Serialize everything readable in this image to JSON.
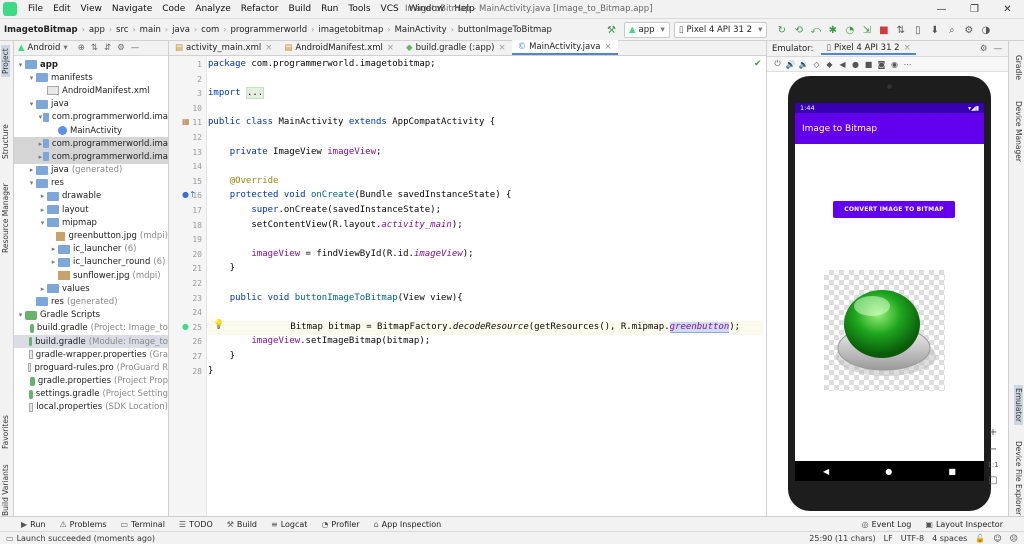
{
  "menu": {
    "items": [
      "File",
      "Edit",
      "View",
      "Navigate",
      "Code",
      "Analyze",
      "Refactor",
      "Build",
      "Run",
      "Tools",
      "VCS",
      "Window",
      "Help"
    ],
    "title": "ImagetoBitmap - MainActivity.java [Image_to_Bitmap.app]"
  },
  "navbar": {
    "crumbs": [
      "ImagetoBitmap",
      "app",
      "src",
      "main",
      "java",
      "com",
      "programmerworld",
      "imagetobitmap",
      "MainActivity",
      "buttonImageToBitmap"
    ],
    "run_config": "app",
    "device": "Pixel 4 API 31 2"
  },
  "leftstrip": {
    "project": "Project",
    "structure": "Structure",
    "resource_manager": "Resource Manager",
    "favorites": "Favorites",
    "build_variants": "Build Variants"
  },
  "rightstrip": {
    "gradle": "Gradle",
    "device_manager": "Device Manager",
    "emulator": "Emulator",
    "device_file_explorer": "Device File Explorer"
  },
  "project": {
    "view": "Android",
    "tree": [
      {
        "label": "app",
        "indent": 0,
        "icon": "fold",
        "arrow": "v",
        "bold": true
      },
      {
        "label": "manifests",
        "indent": 1,
        "icon": "fold",
        "arrow": "v"
      },
      {
        "label": "AndroidManifest.xml",
        "indent": 2,
        "icon": "fdoc",
        "arrow": ""
      },
      {
        "label": "java",
        "indent": 1,
        "icon": "fold",
        "arrow": "v"
      },
      {
        "label": "com.programmerworld.ima",
        "indent": 2,
        "icon": "fold",
        "arrow": "v"
      },
      {
        "label": "MainActivity",
        "indent": 3,
        "icon": "fcls",
        "arrow": ""
      },
      {
        "label": "com.programmerworld.ima",
        "indent": 2,
        "icon": "fold",
        "arrow": ">",
        "cls": "hl"
      },
      {
        "label": "com.programmerworld.ima",
        "indent": 2,
        "icon": "fold",
        "arrow": ">",
        "cls": "hl"
      },
      {
        "label": "java",
        "dim": "(generated)",
        "indent": 1,
        "icon": "fold",
        "arrow": ">"
      },
      {
        "label": "res",
        "indent": 1,
        "icon": "fold",
        "arrow": "v"
      },
      {
        "label": "drawable",
        "indent": 2,
        "icon": "fold",
        "arrow": ">"
      },
      {
        "label": "layout",
        "indent": 2,
        "icon": "fold",
        "arrow": ">"
      },
      {
        "label": "mipmap",
        "indent": 2,
        "icon": "fold",
        "arrow": "v"
      },
      {
        "label": "greenbutton.jpg",
        "dim": "(mdpi)",
        "indent": 3,
        "icon": "fimg",
        "arrow": ""
      },
      {
        "label": "ic_launcher",
        "dim": "(6)",
        "indent": 3,
        "icon": "fold",
        "arrow": ">"
      },
      {
        "label": "ic_launcher_round",
        "dim": "(6)",
        "indent": 3,
        "icon": "fold",
        "arrow": ">"
      },
      {
        "label": "sunflower.jpg",
        "dim": "(mdpi)",
        "indent": 3,
        "icon": "fimg",
        "arrow": ""
      },
      {
        "label": "values",
        "indent": 2,
        "icon": "fold",
        "arrow": ">"
      },
      {
        "label": "res",
        "dim": "(generated)",
        "indent": 1,
        "icon": "fold",
        "arrow": ""
      },
      {
        "label": "Gradle Scripts",
        "indent": 0,
        "icon": "fgr",
        "arrow": "v"
      },
      {
        "label": "build.gradle",
        "dim": "(Project: Image_to",
        "indent": 1,
        "icon": "fgr",
        "arrow": ""
      },
      {
        "label": "build.gradle",
        "dim": "(Module: Image_to",
        "indent": 1,
        "icon": "fgr",
        "arrow": "",
        "cls": "hlsel"
      },
      {
        "label": "gradle-wrapper.properties",
        "dim": "(Gra",
        "indent": 1,
        "icon": "fdoc",
        "arrow": ""
      },
      {
        "label": "proguard-rules.pro",
        "dim": "(ProGuard R",
        "indent": 1,
        "icon": "fdoc",
        "arrow": ""
      },
      {
        "label": "gradle.properties",
        "dim": "(Project Prop",
        "indent": 1,
        "icon": "fgr",
        "arrow": ""
      },
      {
        "label": "settings.gradle",
        "dim": "(Project Setting",
        "indent": 1,
        "icon": "fgr",
        "arrow": ""
      },
      {
        "label": "local.properties",
        "dim": "(SDK Location)",
        "indent": 1,
        "icon": "fdoc",
        "arrow": ""
      }
    ]
  },
  "tabs": [
    {
      "label": "activity_main.xml",
      "active": false
    },
    {
      "label": "AndroidManifest.xml",
      "active": false
    },
    {
      "label": "build.gradle (:app)",
      "active": false
    },
    {
      "label": "MainActivity.java",
      "active": true
    }
  ],
  "code": {
    "line_numbers": [
      "1",
      "2",
      "3",
      "10",
      "11",
      "12",
      "13",
      "14",
      "15",
      "16",
      "17",
      "18",
      "19",
      "20",
      "21",
      "22",
      "23",
      "24",
      "25",
      "26",
      "27",
      "28"
    ],
    "current_line": "25",
    "lines": [
      "<span class='kw'>package</span> com.programmerworld.imagetobitmap;",
      "",
      "<span class='kw'>import</span> <span class='fold-ref'>...</span>",
      "",
      "<span class='kw'>public class</span> MainActivity <span class='kw'>extends</span> AppCompatActivity {",
      "",
      "    <span class='kw'>private</span> ImageView <span class='fd'>imageView</span>;",
      "",
      "    <span class='an'>@Override</span>",
      "    <span class='kw'>protected void</span> <span class='fn'>onCreate</span>(Bundle savedInstanceState) {",
      "        <span class='kw'>super</span>.onCreate(savedInstanceState);",
      "        setContentView(R.layout.<span class='fd it'>activity_main</span>);",
      "",
      "        <span class='fd'>imageView</span> = findViewById(R.id.<span class='fd it'>imageView</span>);",
      "    }",
      "",
      "    <span class='kw'>public void</span> <span class='fn'>buttonImageToBitmap</span>(View view){",
      "",
      "        Bitmap bitmap = BitmapFactory.<span class='it'>decodeResource</span>(getResources(), R.mipmap.<span class='fd it sel-word'>greenbutton</span>);",
      "        <span class='fd'>imageView</span>.setImageBitmap(bitmap);",
      "    }",
      "}"
    ]
  },
  "emulator": {
    "label": "Emulator:",
    "device_tab": "Pixel 4 API 31 2",
    "status_time": "1:44",
    "app_title": "Image to Bitmap",
    "button_label": "CONVERT IMAGE TO BITMAP",
    "zoom_ratio": "1:1"
  },
  "bottombar": [
    {
      "icon": "▶",
      "label": "Run"
    },
    {
      "icon": "⚠",
      "label": "Problems"
    },
    {
      "icon": "▭",
      "label": "Terminal"
    },
    {
      "icon": "☰",
      "label": "TODO"
    },
    {
      "icon": "⚒",
      "label": "Build"
    },
    {
      "icon": "≡",
      "label": "Logcat"
    },
    {
      "icon": "◔",
      "label": "Profiler"
    },
    {
      "icon": "⌂",
      "label": "App Inspection"
    }
  ],
  "bottom_right": [
    {
      "icon": "◎",
      "label": "Event Log"
    },
    {
      "icon": "▣",
      "label": "Layout Inspector"
    }
  ],
  "status": {
    "message": "Launch succeeded (moments ago)",
    "position": "25:90 (11 chars)",
    "line_sep": "LF",
    "encoding": "UTF-8",
    "indent": "4 spaces"
  },
  "colors": {
    "accent": "#6200ee",
    "status_bar": "#3700b3",
    "android_green": "#3ddc84"
  }
}
